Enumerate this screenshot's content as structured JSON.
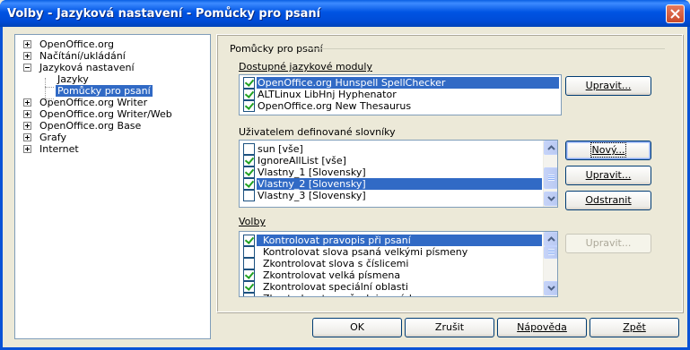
{
  "window": {
    "title": "Volby - Jazyková nastavení - Pomůcky pro psaní",
    "close_icon": "close-icon"
  },
  "tree": {
    "items": [
      {
        "label": "OpenOffice.org",
        "expander": "plus"
      },
      {
        "label": "Načítání/ukládání",
        "expander": "plus"
      },
      {
        "label": "Jazyková nastavení",
        "expander": "minus"
      },
      {
        "label": "Jazyky",
        "expander": "none"
      },
      {
        "label": "Pomůcky pro psaní",
        "expander": "none",
        "selected": true
      },
      {
        "label": "OpenOffice.org Writer",
        "expander": "plus"
      },
      {
        "label": "OpenOffice.org Writer/Web",
        "expander": "plus"
      },
      {
        "label": "OpenOffice.org Base",
        "expander": "plus"
      },
      {
        "label": "Grafy",
        "expander": "plus"
      },
      {
        "label": "Internet",
        "expander": "plus"
      }
    ]
  },
  "group": {
    "title": "Pomůcky pro psaní"
  },
  "modules": {
    "label": "Dostupné jazykové moduly",
    "items": [
      {
        "label": "OpenOffice.org Hunspell SpellChecker",
        "checked": true,
        "selected": true
      },
      {
        "label": "ALTLinux LibHnj Hyphenator",
        "checked": true
      },
      {
        "label": "OpenOffice.org New Thesaurus",
        "checked": true
      }
    ],
    "edit_button": "Upravit..."
  },
  "dictionaries": {
    "label": "Uživatelem definované slovníky",
    "items": [
      {
        "label": "sun [vše]",
        "checked": false
      },
      {
        "label": "IgnoreAllList [vše]",
        "checked": true
      },
      {
        "label": "Vlastny_1 [Slovensky]",
        "checked": true
      },
      {
        "label": "Vlastny_2 [Slovensky]",
        "checked": true,
        "selected": true
      },
      {
        "label": "Vlastny_3 [Slovensky]",
        "checked": false
      }
    ],
    "new_button": "Nový...",
    "edit_button": "Upravit...",
    "delete_button": "Odstranit"
  },
  "options": {
    "label": "Volby",
    "items": [
      {
        "label": "Kontrolovat pravopis při psaní",
        "checked": true,
        "selected": true
      },
      {
        "label": "Kontrolovat slova psaná velkými písmeny",
        "checked": false
      },
      {
        "label": "Zkontrolovat slova s číslicemi",
        "checked": false
      },
      {
        "label": "Zkontrolovat velká písmena",
        "checked": true
      },
      {
        "label": "Zkontrolovat speciální oblasti",
        "checked": true
      },
      {
        "label": "Zkontrolovat ve všech jazycích",
        "checked": false
      }
    ],
    "edit_button": "Upravit..."
  },
  "footer": {
    "ok": "OK",
    "cancel": "Zrušit",
    "help": "Nápověda",
    "back": "Zpět"
  }
}
